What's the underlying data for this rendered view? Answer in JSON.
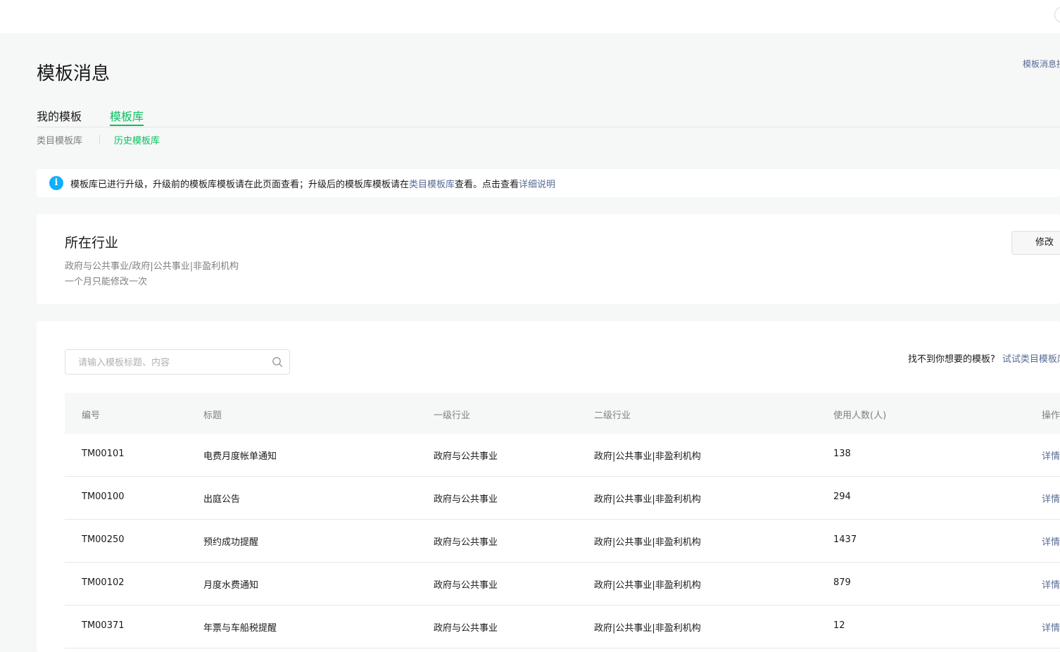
{
  "header": {
    "title": "模板消息",
    "doc_link": "模板消息接口文档"
  },
  "tabs": [
    {
      "label": "我的模板"
    },
    {
      "label": "模板库"
    }
  ],
  "subtabs": [
    {
      "label": "类目模板库"
    },
    {
      "label": "历史模板库"
    }
  ],
  "notice": {
    "text_before": "模板库已进行升级，升级前的模板库模板请在此页面查看；升级后的模板库模板请在",
    "link1": "类目模板库",
    "text_middle": "查看。点击查看",
    "link2": "详细说明"
  },
  "industry": {
    "title": "所在行业",
    "value": "政府与公共事业/政府|公共事业|非盈利机构",
    "hint": "一个月只能修改一次",
    "edit_label": "修改"
  },
  "search": {
    "placeholder": "请输入模板标题、内容"
  },
  "cant_find": {
    "question": "找不到你想要的模板?",
    "link": "试试类目模板库"
  },
  "table": {
    "columns": [
      "编号",
      "标题",
      "一级行业",
      "二级行业",
      "使用人数(人)",
      "操作"
    ],
    "rows": [
      {
        "id": "TM00101",
        "title": "电费月度帐单通知",
        "industry1": "政府与公共事业",
        "industry2": "政府|公共事业|非盈利机构",
        "users": "138",
        "action": "详情"
      },
      {
        "id": "TM00100",
        "title": "出庭公告",
        "industry1": "政府与公共事业",
        "industry2": "政府|公共事业|非盈利机构",
        "users": "294",
        "action": "详情"
      },
      {
        "id": "TM00250",
        "title": "预约成功提醒",
        "industry1": "政府与公共事业",
        "industry2": "政府|公共事业|非盈利机构",
        "users": "1437",
        "action": "详情"
      },
      {
        "id": "TM00102",
        "title": "月度水费通知",
        "industry1": "政府与公共事业",
        "industry2": "政府|公共事业|非盈利机构",
        "users": "879",
        "action": "详情"
      },
      {
        "id": "TM00371",
        "title": "年票与车船税提醒",
        "industry1": "政府与公共事业",
        "industry2": "政府|公共事业|非盈利机构",
        "users": "12",
        "action": "详情"
      }
    ]
  },
  "colors": {
    "accent_green": "#07c160",
    "link_blue": "#576b95",
    "info_blue": "#10aeff"
  }
}
